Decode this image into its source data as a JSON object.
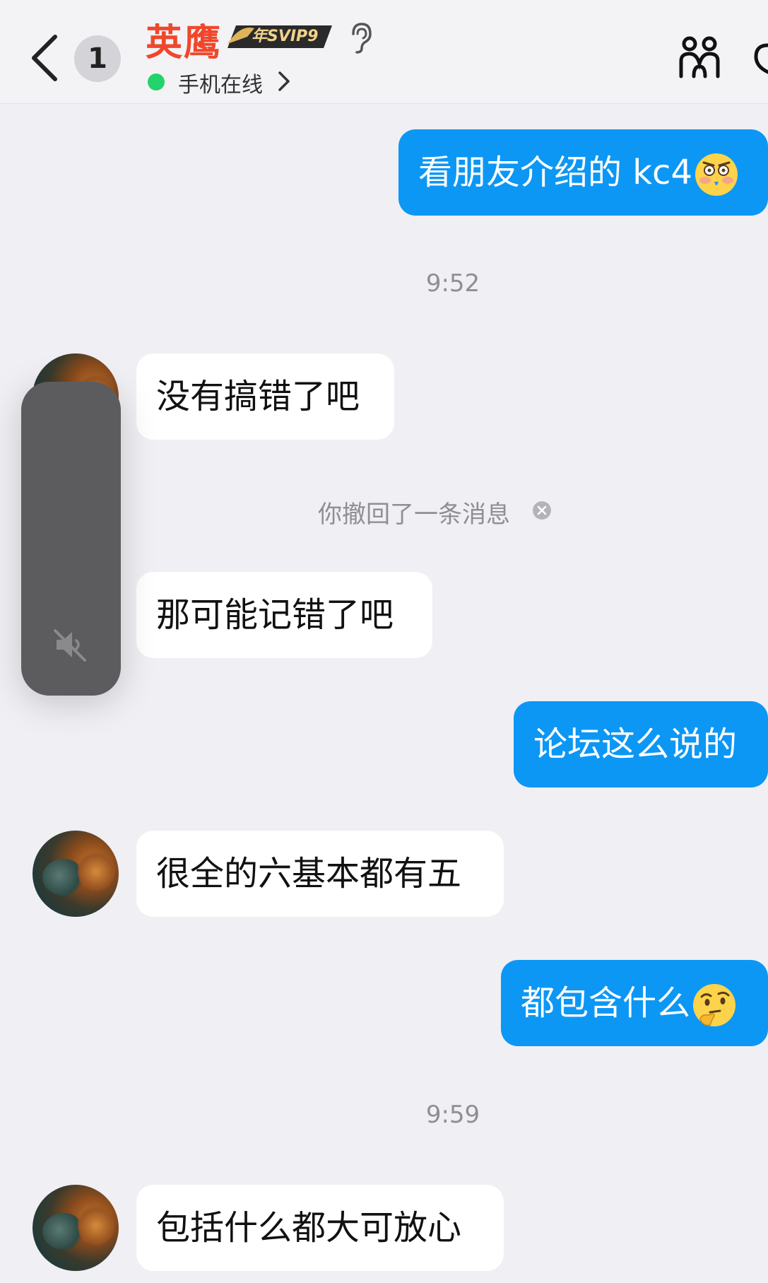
{
  "header": {
    "unread_count": "1",
    "contact_name": "英鹰",
    "vip_badge": "年SVIP9",
    "status": "手机在线",
    "icons": [
      "back-icon",
      "ear-icon",
      "chevron-right-icon",
      "group-icon"
    ]
  },
  "messages": [
    {
      "type": "out",
      "text": "看朋友介绍的 kc4",
      "emoji": "flushed-face"
    },
    {
      "type": "time",
      "text": "9:52"
    },
    {
      "type": "in",
      "text": "没有搞错了吧"
    },
    {
      "type": "system",
      "text": "你撤回了一条消息"
    },
    {
      "type": "in",
      "text": "那可能记错了吧"
    },
    {
      "type": "out",
      "text": "论坛这么说的"
    },
    {
      "type": "in",
      "text": "很全的六基本都有五"
    },
    {
      "type": "out",
      "text": "都包含什么",
      "emoji": "thinking-face"
    },
    {
      "type": "time",
      "text": "9:59"
    },
    {
      "type": "in",
      "text": "包括什么都大可放心"
    }
  ],
  "overlay": {
    "name": "mute-volume-slider",
    "icon": "speaker-muted-icon"
  },
  "colors": {
    "outgoing_bubble": "#0c97f5",
    "incoming_bubble": "#ffffff",
    "background": "#efeff4",
    "contact_name": "#f0472c",
    "online_dot": "#24d36b"
  }
}
